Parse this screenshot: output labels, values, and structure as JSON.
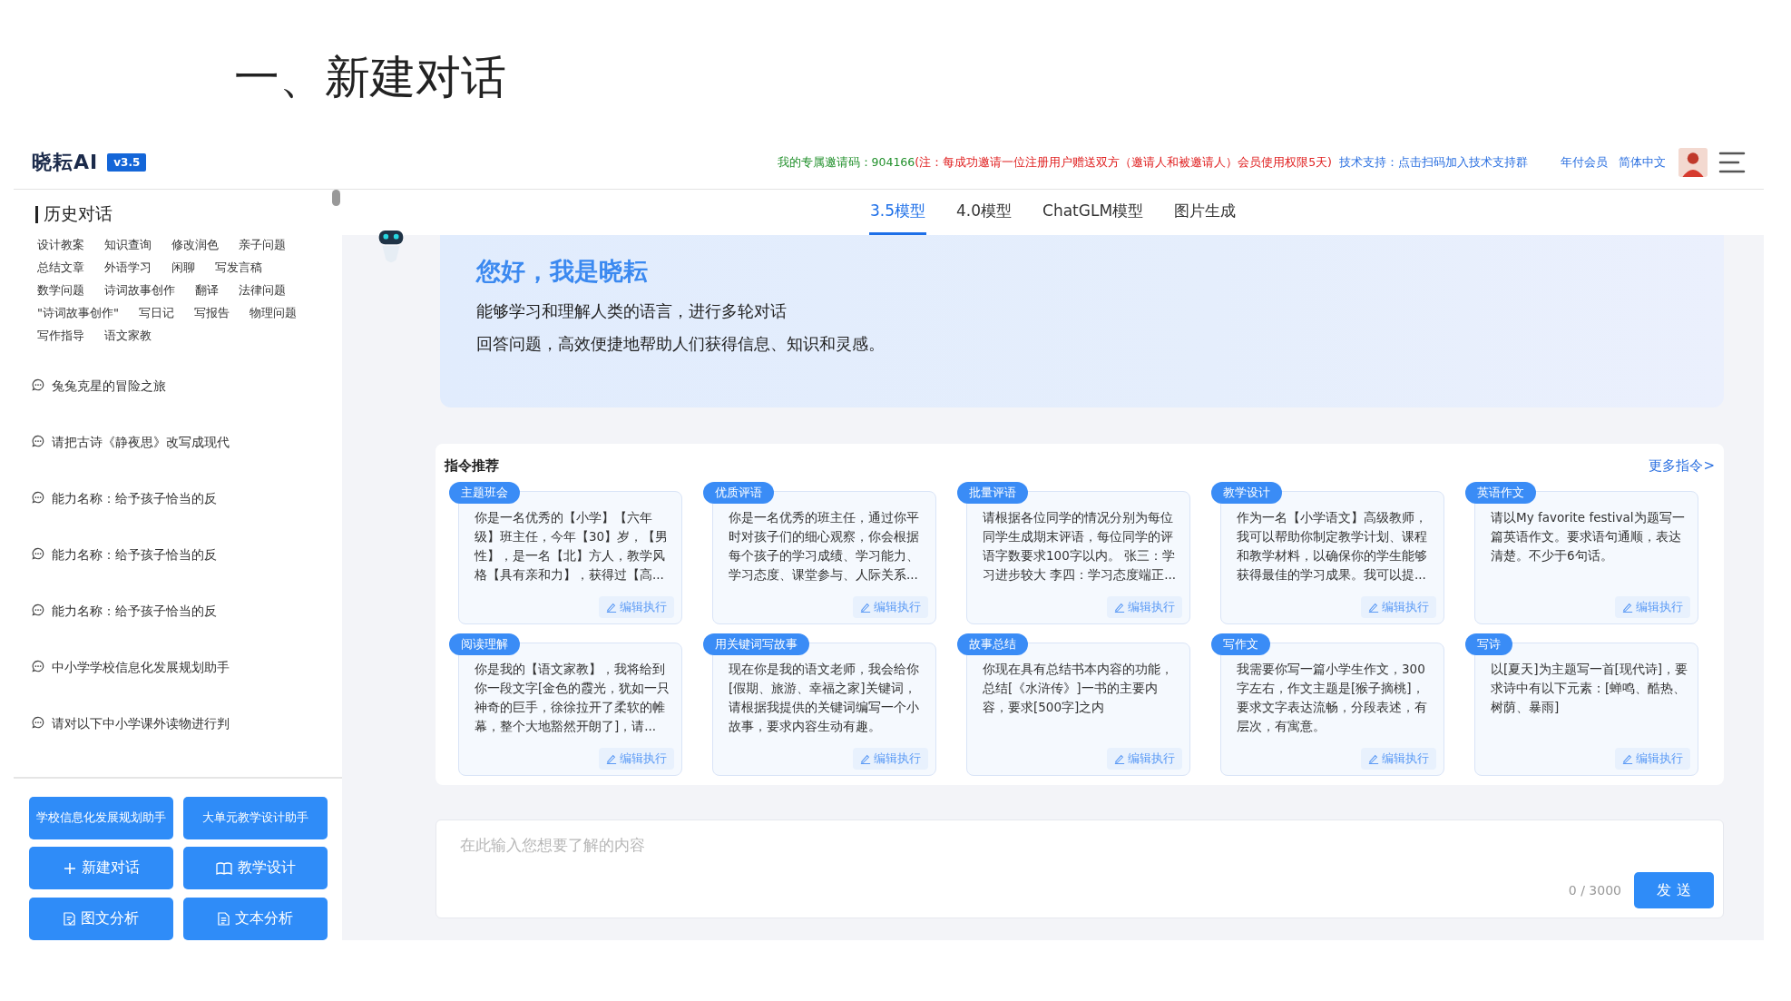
{
  "slide_title": "一、新建对话",
  "header": {
    "logo": "晓耘AI",
    "version": "v3.5",
    "invite_label": "我的专属邀请码：904166",
    "invite_note": "(注：每成功邀请一位注册用户赠送双方（邀请人和被邀请人）会员使用权限5天)",
    "support_label": "技术支持：",
    "support_link": "点击扫码加入技术支持群",
    "links": [
      "年付会员",
      "简体中文"
    ]
  },
  "sidebar": {
    "title": "历史对话",
    "tags": [
      "设计教案",
      "知识查询",
      "修改润色",
      "亲子问题",
      "总结文章",
      "外语学习",
      "闲聊",
      "写发言稿",
      "数学问题",
      "诗词故事创作",
      "翻译",
      "法律问题",
      "\"诗词故事创作\"",
      "写日记",
      "写报告",
      "物理问题",
      "写作指导",
      "语文家教"
    ],
    "history": [
      "兔兔克星的冒险之旅",
      "请把古诗《静夜思》改写成现代",
      "能力名称：给予孩子恰当的反",
      "能力名称：给予孩子恰当的反",
      "能力名称：给予孩子恰当的反",
      "中小学学校信息化发展规划助手",
      "请对以下中小学课外读物进行判"
    ],
    "buttons": [
      {
        "label": "学校信息化发展规划助手",
        "kind": "text"
      },
      {
        "label": "大单元教学设计助手",
        "kind": "text"
      },
      {
        "label": "新建对话",
        "kind": "plus"
      },
      {
        "label": "教学设计",
        "kind": "book"
      },
      {
        "label": "图文分析",
        "kind": "doc-check"
      },
      {
        "label": "文本分析",
        "kind": "doc"
      }
    ]
  },
  "tabs": [
    {
      "label": "3.5模型",
      "selected": true
    },
    {
      "label": "4.0模型",
      "selected": false
    },
    {
      "label": "ChatGLM模型",
      "selected": false
    },
    {
      "label": "图片生成",
      "selected": false
    }
  ],
  "welcome": {
    "title": "您好，我是晓耘",
    "lines": [
      "能够学习和理解人类的语言，进行多轮对话",
      "回答问题，高效便捷地帮助人们获得信息、知识和灵感。"
    ]
  },
  "commands": {
    "title": "指令推荐",
    "more": "更多指令>",
    "cards": [
      {
        "tag": "主题班会",
        "text": "你是一名优秀的【小学】【六年级】班主任，今年【30】岁，【男性】，是一名【北】方人，教学风格【具有亲和力】，获得过【高...",
        "action": "编辑执行"
      },
      {
        "tag": "优质评语",
        "text": "你是一名优秀的班主任，通过你平时对孩子们的细心观察，你会根据每个孩子的学习成绩、学习能力、学习态度、课堂参与、人际关系...",
        "action": "编辑执行"
      },
      {
        "tag": "批量评语",
        "text": "请根据各位同学的情况分别为每位同学生成期末评语，每位同学的评语字数要求100字以内。 张三：学习进步较大 李四：学习态度端正...",
        "action": "编辑执行"
      },
      {
        "tag": "教学设计",
        "text": "作为一名【小学语文】高级教师，我可以帮助你制定教学计划、课程和教学材料，以确保你的学生能够获得最佳的学习成果。我可以提...",
        "action": "编辑执行"
      },
      {
        "tag": "英语作文",
        "text": "请以My favorite festival为题写一篇英语作文。要求语句通顺，表达清楚。不少于6句话。",
        "action": "编辑执行"
      },
      {
        "tag": "阅读理解",
        "text": "你是我的【语文家教】，我将给到你一段文字[金色的霞光，犹如一只神奇的巨手，徐徐拉开了柔软的帷幕，整个大地豁然开朗了]，请...",
        "action": "编辑执行"
      },
      {
        "tag": "用关键词写故事",
        "text": "现在你是我的语文老师，我会给你[假期、旅游、幸福之家]关键词，请根据我提供的关键词编写一个小故事，要求内容生动有趣。",
        "action": "编辑执行"
      },
      {
        "tag": "故事总结",
        "text": "你现在具有总结书本内容的功能，总结[《水浒传》]一书的主要内容，要求[500字]之内",
        "action": "编辑执行"
      },
      {
        "tag": "写作文",
        "text": "我需要你写一篇小学生作文，300字左右，作文主题是[猴子摘桃]，要求文字表达流畅，分段表述，有层次，有寓意。",
        "action": "编辑执行"
      },
      {
        "tag": "写诗",
        "text": "以[夏天]为主题写一首[现代诗]，要求诗中有以下元素：[蝉鸣、酷热、树荫、暴雨]",
        "action": "编辑执行"
      }
    ]
  },
  "input": {
    "placeholder": "在此输入您想要了解的内容",
    "counter": "0 / 3000",
    "send": "发 送"
  }
}
